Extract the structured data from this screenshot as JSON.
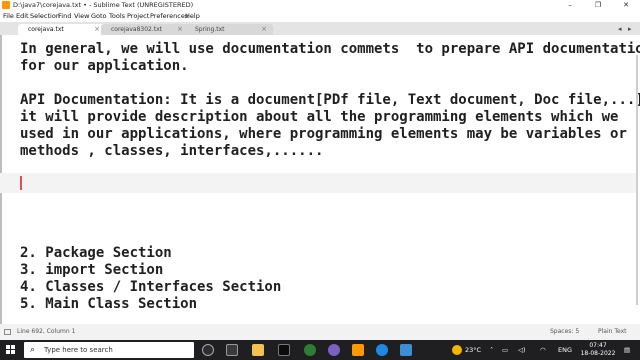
{
  "window": {
    "title": "D:\\java7\\corejava.txt • - Sublime Text (UNREGISTERED)",
    "minimize": "–",
    "maximize": "❐",
    "close": "✕"
  },
  "menu": [
    "File",
    "Edit",
    "Selection",
    "Find",
    "View",
    "Goto",
    "Tools",
    "Project",
    "Preferences",
    "Help"
  ],
  "tabs": [
    {
      "label": "corejava.txt",
      "close": "×",
      "active": true
    },
    {
      "label": "corejava8302.txt",
      "close": "×",
      "active": false
    },
    {
      "label": "Spring.txt",
      "close": "×",
      "active": false
    }
  ],
  "tab_scroll": {
    "left": "◂",
    "right": "▸"
  },
  "editor": {
    "lines": [
      "In general, we will use documentation commets  to prepare API documentation",
      "for our application.",
      "",
      "API Documentation: It is a document[PDf file, Text document, Doc file,...],",
      "it will provide description about all the programming elements which we",
      "used in our applications, where programming elements may be variables or",
      "methods , classes, interfaces,......"
    ],
    "sections": [
      "2. Package Section",
      "3. import Section",
      "4. Classes / Interfaces Section",
      "5. Main Class Section"
    ]
  },
  "status": {
    "position": "Line 692, Column 1",
    "indent": "Spaces: 5",
    "syntax": "Plain Text"
  },
  "taskbar": {
    "search_placeholder": "Type here to search",
    "weather": "23°C",
    "language": "ENG",
    "time": "07:47",
    "date": "18-08-2022"
  },
  "colors": {
    "accent_sublime": "#ff9800",
    "caret": "#e05050",
    "taskbar": "#1f1f22"
  }
}
